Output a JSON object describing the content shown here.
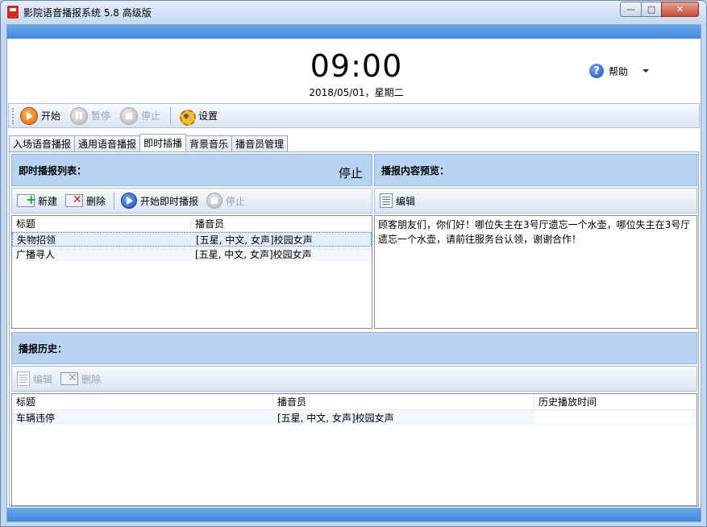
{
  "window": {
    "title": "影院语音播报系统 5.8 高级版",
    "min": "—",
    "max": "□",
    "close": "✕"
  },
  "clock": {
    "time": "09:00",
    "date": "2018/05/01，星期二"
  },
  "help": {
    "label": "帮助",
    "icon": "help-icon"
  },
  "toolbar": {
    "start": "开始",
    "pause": "暂停",
    "stop": "停止",
    "settings": "设置"
  },
  "tabs": [
    {
      "label": "入场语音播报"
    },
    {
      "label": "通用语音播报"
    },
    {
      "label": "即时插播",
      "active": true
    },
    {
      "label": "背景音乐"
    },
    {
      "label": "播音员管理"
    }
  ],
  "instant": {
    "list_title": "即时播报列表：",
    "status": "停止",
    "new": "新建",
    "delete": "删除",
    "start_instant": "开始即时播报",
    "stop": "停止",
    "columns": [
      "标题",
      "播音员"
    ],
    "rows": [
      {
        "title": "失物招领",
        "announcer": "[五星, 中文, 女声]校园女声",
        "selected": true
      },
      {
        "title": "广播寻人",
        "announcer": "[五星, 中文, 女声]校园女声"
      }
    ]
  },
  "preview": {
    "title": "播报内容预览：",
    "edit": "编辑",
    "text": "顾客朋友们，你们好！哪位失主在3号厅遗忘一个水壶，哪位失主在3号厅遗忘一个水壶，请前往服务台认领，谢谢合作！"
  },
  "history": {
    "title": "播报历史：",
    "edit": "编辑",
    "delete": "删除",
    "columns": [
      "标题",
      "播音员",
      "历史播放时间"
    ],
    "rows": [
      {
        "title": "车辆违停",
        "announcer": "[五星, 中文, 女声]校园女声",
        "time": ""
      }
    ]
  },
  "colors": {
    "accent": "#3f88de",
    "panel_header": "#b9d4f2",
    "play_orange": "#e06a00"
  }
}
